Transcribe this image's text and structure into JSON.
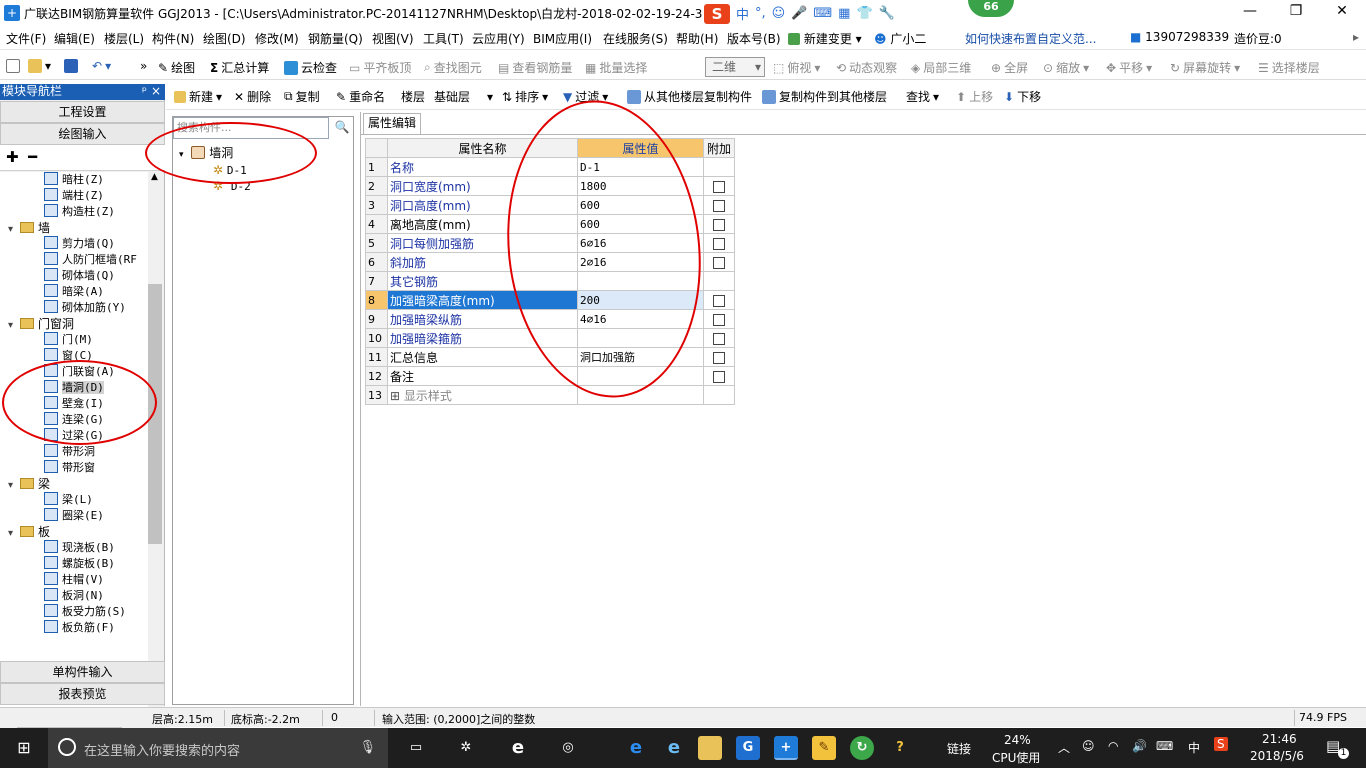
{
  "window": {
    "title": "广联达BIM钢筋算量软件 GGJ2013 - [C:\\Users\\Administrator.PC-20141127NRHM\\Desktop\\白龙村-2018-02-02-19-24-35",
    "badge": "66",
    "ime": {
      "lang": "中",
      "punct": "°,"
    }
  },
  "menubar": {
    "items": [
      "文件(F)",
      "编辑(E)",
      "楼层(L)",
      "构件(N)",
      "绘图(D)",
      "修改(M)",
      "钢筋量(Q)",
      "视图(V)",
      "工具(T)",
      "云应用(Y)",
      "BIM应用(I)",
      "在线服务(S)",
      "帮助(H)",
      "版本号(B)"
    ],
    "new_change": "新建变更",
    "assistant": "广小二",
    "tip_link": "如何快速布置自定义范...",
    "phone": "13907298339",
    "beans": "造价豆:0"
  },
  "toolbar1": {
    "draw": "绘图",
    "sum": "汇总计算",
    "cloud_check": "云检查",
    "align_slab": "平齐板顶",
    "find_element": "查找图元",
    "view_rebar": "查看钢筋量",
    "batch_select": "批量选择",
    "view_mode": "二维",
    "top_view": "俯视",
    "dynamic_view": "动态观察",
    "local_3d": "局部三维",
    "full_screen": "全屏",
    "zoom": "缩放",
    "pan": "平移",
    "rotate": "屏幕旋转",
    "select_floor": "选择楼层"
  },
  "toolbar2": {
    "new": "新建",
    "delete": "删除",
    "copy": "复制",
    "rename": "重命名",
    "floor_label": "楼层",
    "floor_value": "基础层",
    "sort": "排序",
    "filter": "过滤",
    "copy_from": "从其他楼层复制构件",
    "copy_to": "复制构件到其他楼层",
    "find": "查找",
    "move_up": "上移",
    "move_down": "下移"
  },
  "nav": {
    "title": "模块导航栏",
    "pin": "ᵖ",
    "close": "×",
    "project_settings": "工程设置",
    "drawing_input": "绘图输入",
    "single_input": "单构件输入",
    "report_preview": "报表预览",
    "tree": [
      {
        "label": "暗柱(Z)",
        "type": "item"
      },
      {
        "label": "端柱(Z)",
        "type": "item"
      },
      {
        "label": "构造柱(Z)",
        "type": "item"
      },
      {
        "label": "墙",
        "type": "category"
      },
      {
        "label": "剪力墙(Q)",
        "type": "item"
      },
      {
        "label": "人防门框墙(RF",
        "type": "item"
      },
      {
        "label": "砌体墙(Q)",
        "type": "item"
      },
      {
        "label": "暗梁(A)",
        "type": "item"
      },
      {
        "label": "砌体加筋(Y)",
        "type": "item"
      },
      {
        "label": "门窗洞",
        "type": "category"
      },
      {
        "label": "门(M)",
        "type": "item"
      },
      {
        "label": "窗(C)",
        "type": "item"
      },
      {
        "label": "门联窗(A)",
        "type": "item"
      },
      {
        "label": "墙洞(D)",
        "type": "item",
        "selected": true
      },
      {
        "label": "壁龛(I)",
        "type": "item"
      },
      {
        "label": "连梁(G)",
        "type": "item"
      },
      {
        "label": "过梁(G)",
        "type": "item"
      },
      {
        "label": "带形洞",
        "type": "item"
      },
      {
        "label": "带形窗",
        "type": "item"
      },
      {
        "label": "梁",
        "type": "category"
      },
      {
        "label": "梁(L)",
        "type": "item"
      },
      {
        "label": "圈梁(E)",
        "type": "item"
      },
      {
        "label": "板",
        "type": "category"
      },
      {
        "label": "现浇板(B)",
        "type": "item"
      },
      {
        "label": "螺旋板(B)",
        "type": "item"
      },
      {
        "label": "柱帽(V)",
        "type": "item"
      },
      {
        "label": "板洞(N)",
        "type": "item"
      },
      {
        "label": "板受力筋(S)",
        "type": "item"
      },
      {
        "label": "板负筋(F)",
        "type": "item"
      }
    ]
  },
  "components": {
    "search_placeholder": "搜索构件...",
    "root": "墙洞",
    "items": [
      "D-1",
      "D-2"
    ]
  },
  "properties": {
    "tab": "属性编辑",
    "headers": {
      "num": "",
      "name": "属性名称",
      "value": "属性值",
      "extra": "附加"
    },
    "rows": [
      {
        "num": "1",
        "name": "名称",
        "value": "D-1",
        "blue": true,
        "checkbox": false
      },
      {
        "num": "2",
        "name": "洞口宽度(mm)",
        "value": "1800",
        "blue": true,
        "checkbox": true
      },
      {
        "num": "3",
        "name": "洞口高度(mm)",
        "value": "600",
        "blue": true,
        "checkbox": true
      },
      {
        "num": "4",
        "name": "离地高度(mm)",
        "value": "600",
        "blue": false,
        "checkbox": true
      },
      {
        "num": "5",
        "name": "洞口每侧加强筋",
        "value": "6⌀16",
        "blue": true,
        "checkbox": true
      },
      {
        "num": "6",
        "name": "斜加筋",
        "value": "2⌀16",
        "blue": true,
        "checkbox": true
      },
      {
        "num": "7",
        "name": "其它钢筋",
        "value": "",
        "blue": true,
        "checkbox": false
      },
      {
        "num": "8",
        "name": "加强暗梁高度(mm)",
        "value": "200",
        "blue": true,
        "checkbox": true,
        "selected": true
      },
      {
        "num": "9",
        "name": "加强暗梁纵筋",
        "value": "4⌀16",
        "blue": true,
        "checkbox": true
      },
      {
        "num": "10",
        "name": "加强暗梁箍筋",
        "value": "",
        "blue": true,
        "checkbox": true
      },
      {
        "num": "11",
        "name": "汇总信息",
        "value": "洞口加强筋",
        "blue": false,
        "checkbox": true
      },
      {
        "num": "12",
        "name": "备注",
        "value": "",
        "blue": false,
        "checkbox": true
      },
      {
        "num": "13",
        "name": "显示样式",
        "value": "",
        "blue": false,
        "checkbox": false,
        "expand": true
      }
    ]
  },
  "statusbar": {
    "floor_height": "层高:2.15m",
    "bottom_elev": "底标高:-2.2m",
    "zero": "0",
    "input_range": "输入范围: (0,2000]之间的整数",
    "fps": "74.9 FPS"
  },
  "taskbar": {
    "search_placeholder": "在这里输入你要搜索的内容",
    "link": "链接",
    "cpu_percent": "24%",
    "cpu_label": "CPU使用",
    "lang": "中",
    "time": "21:46",
    "date": "2018/5/6",
    "notif": "1"
  },
  "colors": {
    "nav_header": "#1a5fb4",
    "selection": "#1f77d4",
    "value_header": "#f7c66c",
    "annotation": "#e00000",
    "taskbar": "#1e1e1e"
  }
}
